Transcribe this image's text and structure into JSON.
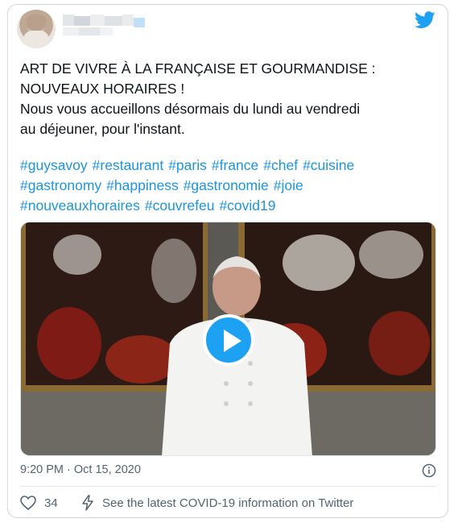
{
  "tweet": {
    "text_lines": [
      "ART DE VIVRE À LA FRANÇAISE ET GOURMANDISE :",
      "NOUVEAUX HORAIRES !",
      "Nous vous accueillons désormais du lundi au vendredi",
      "au déjeuner, pour l'instant."
    ],
    "hashtags": [
      "#guysavoy",
      "#restaurant",
      "#paris",
      "#france",
      "#chef",
      "#cuisine",
      "#gastronomy",
      "#happiness",
      "#gastronomie",
      "#joie",
      "#nouveauxhoraires",
      "#couvrefeu",
      "#covid19"
    ],
    "timestamp": "9:20 PM · Oct 15, 2020",
    "like_count": "34",
    "covid_info": "See the latest COVID-19 information on Twitter"
  },
  "icons": {
    "brand": "twitter-bird-icon",
    "play": "play-icon",
    "info": "info-icon",
    "like": "heart-icon",
    "covid": "lightning-icon"
  },
  "colors": {
    "accent": "#1da1f2",
    "hashtag": "#1b95e0",
    "text": "#0f1419",
    "muted": "#536471",
    "border": "#cfd9de"
  }
}
